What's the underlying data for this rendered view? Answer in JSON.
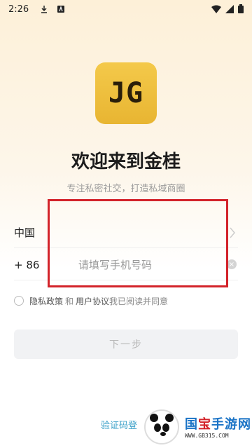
{
  "status": {
    "time": "2:26"
  },
  "logo": {
    "text": "JG"
  },
  "header": {
    "title": "欢迎来到金桂",
    "subtitle": "专注私密社交，打造私域商圈"
  },
  "form": {
    "country_label": "中国",
    "country_code": "+ 86",
    "phone_placeholder": "请填写手机号码",
    "agreement": {
      "privacy": "隐私政策",
      "and": "和",
      "user_agreement": "用户协议",
      "suffix": "我已阅读并同意"
    },
    "next_label": "下一步",
    "sms_login": "验证码登"
  },
  "watermark": {
    "main_blue": "国",
    "main_red": "宝",
    "main_rest": "手游网",
    "sub": "WWW.GB315.COM"
  },
  "colors": {
    "highlight_box": "#d3232a",
    "accent_link": "#3aa0c8",
    "logo_bg": "#f4c94a"
  }
}
